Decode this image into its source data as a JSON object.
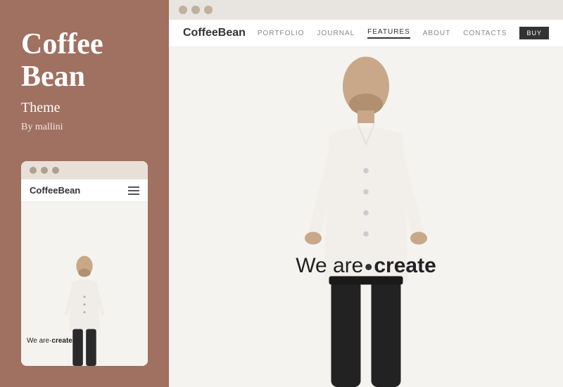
{
  "sidebar": {
    "title_line1": "Coffee",
    "title_line2": "Bean",
    "subtitle": "Theme",
    "author": "By mallini"
  },
  "mobile_preview": {
    "logo_light": "Coffee",
    "logo_bold": "Bean",
    "tagline_normal": "We are·",
    "tagline_bold": "create",
    "window_dots": [
      "dot1",
      "dot2",
      "dot3"
    ]
  },
  "desktop_preview": {
    "logo_light": "Coffee",
    "logo_bold": "Bean",
    "tagline_normal": "We are·",
    "tagline_bold": "create",
    "menu_items": [
      {
        "label": "PORTFOLIO",
        "active": false
      },
      {
        "label": "JOURNAL",
        "active": false
      },
      {
        "label": "FEATURES",
        "active": true
      },
      {
        "label": "ABOUT",
        "active": false
      },
      {
        "label": "CONTACTS",
        "active": false
      },
      {
        "label": "BUY",
        "active": false,
        "is_buy": true
      }
    ],
    "window_dots": [
      "dot1",
      "dot2",
      "dot3"
    ]
  }
}
